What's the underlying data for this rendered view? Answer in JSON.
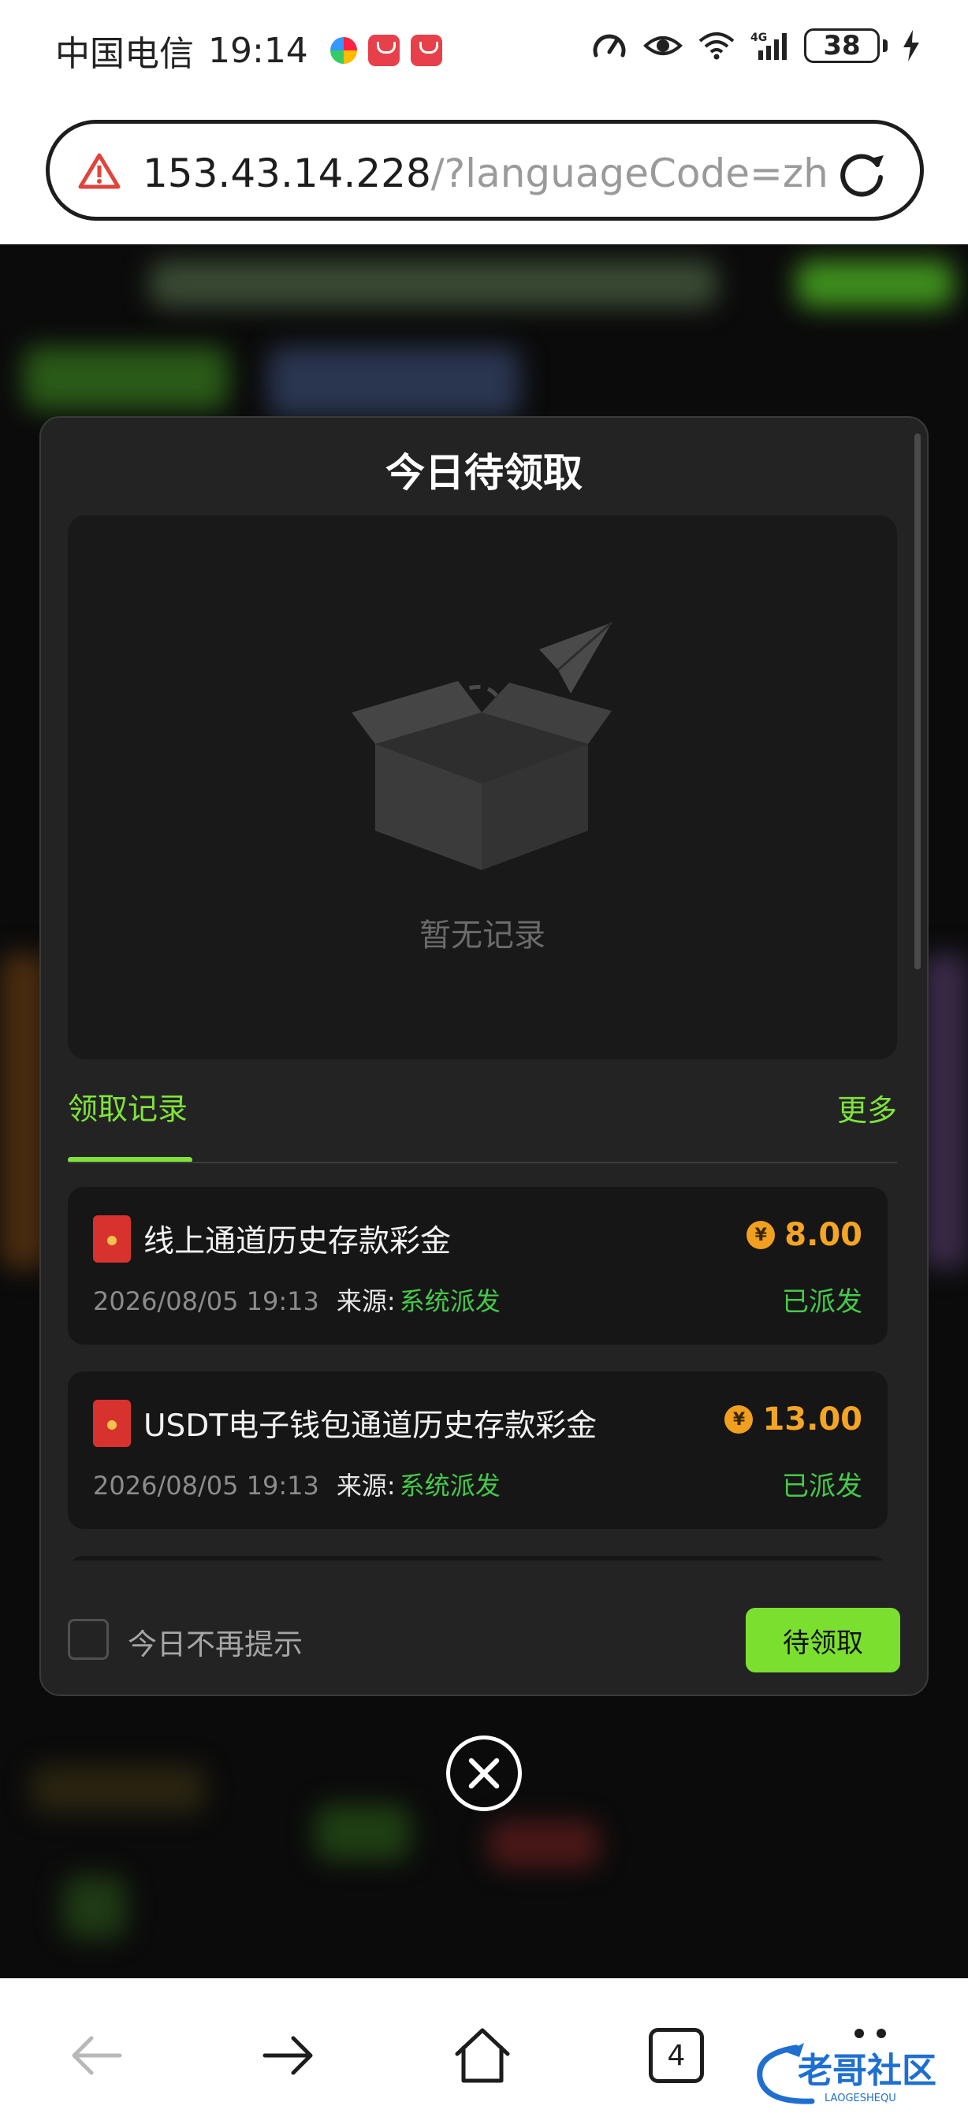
{
  "status_bar": {
    "carrier": "中国电信",
    "time": "19:14",
    "battery": "38",
    "icons": [
      "pinwheel-icon",
      "huawei-app-icon",
      "huawei-app-icon",
      "speedometer-icon",
      "eye-icon",
      "wifi-icon",
      "signal-4g-icon",
      "battery-icon",
      "charging-bolt-icon"
    ]
  },
  "address_bar": {
    "host": "153.43.14.228",
    "query": "/?languageCode=zh",
    "icons": [
      "warning-icon",
      "reload-icon"
    ]
  },
  "modal": {
    "title": "今日待领取",
    "empty_text": "暂无记录",
    "records_tab": "领取记录",
    "more_link": "更多",
    "records": [
      {
        "title": "线上通道历史存款彩金",
        "amount": "8.00",
        "time": "2026/08/05 19:13",
        "source_label": "来源:",
        "source_value": "系统派发",
        "status": "已派发"
      },
      {
        "title": "USDT电子钱包通道历史存款彩金",
        "amount": "13.00",
        "time": "2026/08/05 19:13",
        "source_label": "来源:",
        "source_value": "系统派发",
        "status": "已派发"
      }
    ],
    "dont_show_label": "今日不再提示",
    "claim_button": "待领取",
    "coin_symbol": "¥"
  },
  "bottom_nav": {
    "tab_count": "4",
    "icons": [
      "back-icon",
      "forward-icon",
      "home-icon",
      "tabs-icon",
      "menu-icon"
    ]
  },
  "watermark": {
    "text": "老哥社区",
    "subtext": "LAOGESHEQU"
  },
  "colors": {
    "accent": "#7adf2f",
    "amount": "#f5a524",
    "status": "#46c94a",
    "modal_bg": "#232323",
    "card_bg": "#161616"
  }
}
